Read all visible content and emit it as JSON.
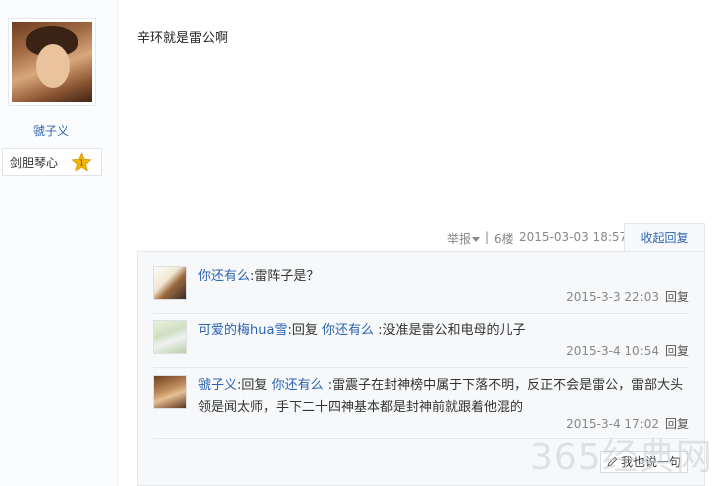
{
  "author": {
    "name": "虢子义",
    "level_name": "剑胆琴心",
    "level_number": "1"
  },
  "post": {
    "content": "辛环就是雷公啊",
    "report_label": "举报",
    "separator": "|",
    "floor": "6楼",
    "timestamp": "2015-03-03 18:57",
    "collapse_label": "收起回复"
  },
  "replies": [
    {
      "user": "你还有么",
      "colon": ":",
      "text": "雷阵子是？",
      "time": "2015-3-3 22:03",
      "reply_label": "回复"
    },
    {
      "user": "可爱的梅hua雪",
      "colon": ":",
      "prefix": "回复",
      "target": "你还有么",
      "text": " :没准是雷公和电母的儿子",
      "time": "2015-3-4 10:54",
      "reply_label": "回复"
    },
    {
      "user": "虢子义",
      "colon": ":",
      "prefix": "回复",
      "target": "你还有么",
      "text": " :雷震子在封神榜中属于下落不明，反正不会是雷公，雷部大头领是闻太师，手下二十四神基本都是封神前就跟着他混的",
      "time": "2015-3-4 17:02",
      "reply_label": "回复"
    }
  ],
  "say_box_label": "我也说一句",
  "watermark_text": "365经典网",
  "colors": {
    "link_blue": "#2d64b3",
    "meta_gray": "#888888",
    "panel_bg": "#f7f8fa",
    "badge_gold": "#f2b600"
  }
}
